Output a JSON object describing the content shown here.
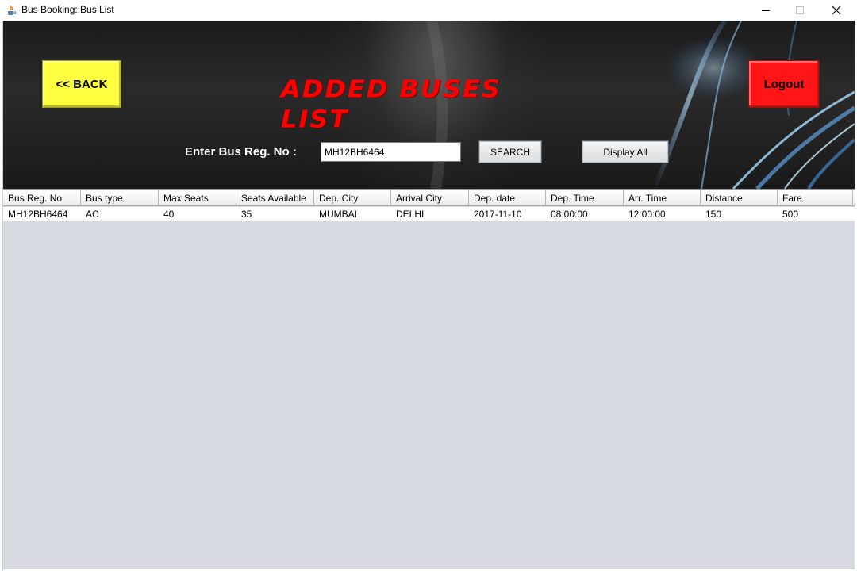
{
  "window": {
    "title": "Bus Booking::Bus List",
    "icon": "java-cup-icon"
  },
  "header": {
    "back_label": "<< BACK",
    "heading": "ADDED BUSES LIST",
    "logout_label": "Logout"
  },
  "search": {
    "label": "Enter Bus Reg. No :",
    "value": "MH12BH6464",
    "search_label": "SEARCH",
    "display_all_label": "Display All"
  },
  "table": {
    "columns": [
      "Bus Reg. No",
      "Bus type",
      "Max Seats",
      "Seats Available",
      "Dep. City",
      "Arrival City",
      "Dep. date",
      "Dep. Time",
      "Arr. Time",
      "Distance",
      "Fare"
    ],
    "rows": [
      [
        "MH12BH6464",
        "AC",
        "40",
        "35",
        "MUMBAI",
        "DELHI",
        "2017-11-10",
        "08:00:00",
        "12:00:00",
        "150",
        "500"
      ]
    ]
  },
  "colors": {
    "back_button": "#ffff40",
    "logout_button": "#ff1515",
    "heading": "#ff0000",
    "table_background": "#d6d9e0"
  }
}
